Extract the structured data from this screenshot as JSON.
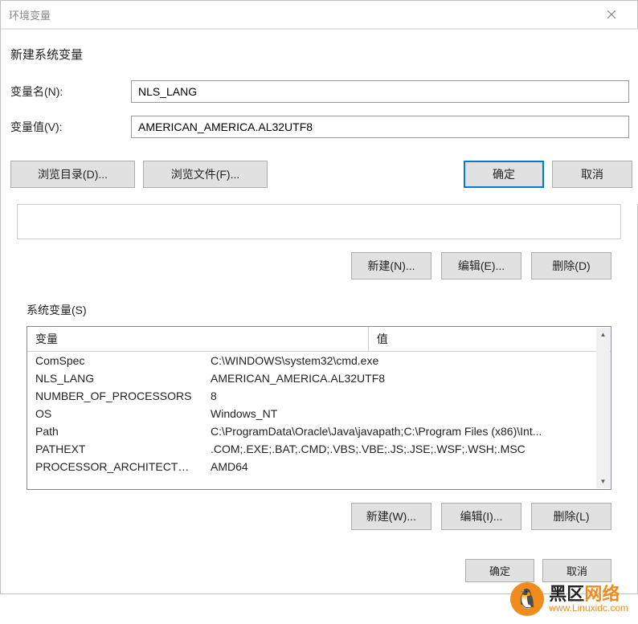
{
  "window": {
    "title": "环境变量"
  },
  "dialog": {
    "title": "新建系统变量",
    "labels": {
      "name": "变量名(N):",
      "value": "变量值(V):"
    },
    "fields": {
      "name": "NLS_LANG",
      "value": "AMERICAN_AMERICA.AL32UTF8"
    },
    "buttons": {
      "browse_dir": "浏览目录(D)...",
      "browse_file": "浏览文件(F)...",
      "ok": "确定",
      "cancel": "取消"
    }
  },
  "upper_actions": {
    "new": "新建(N)...",
    "edit": "编辑(E)...",
    "delete": "删除(D)"
  },
  "sys_vars": {
    "label": "系统变量(S)",
    "columns": {
      "var": "变量",
      "val": "值"
    },
    "rows": [
      {
        "name": "ComSpec",
        "value": "C:\\WINDOWS\\system32\\cmd.exe"
      },
      {
        "name": "NLS_LANG",
        "value": "AMERICAN_AMERICA.AL32UTF8"
      },
      {
        "name": "NUMBER_OF_PROCESSORS",
        "value": "8"
      },
      {
        "name": "OS",
        "value": "Windows_NT"
      },
      {
        "name": "Path",
        "value": "C:\\ProgramData\\Oracle\\Java\\javapath;C:\\Program Files (x86)\\Int..."
      },
      {
        "name": "PATHEXT",
        "value": ".COM;.EXE;.BAT;.CMD;.VBS;.VBE;.JS;.JSE;.WSF;.WSH;.MSC"
      },
      {
        "name": "PROCESSOR_ARCHITECTURE",
        "value": "AMD64"
      }
    ],
    "actions": {
      "new": "新建(W)...",
      "edit": "编辑(I)...",
      "delete": "删除(L)"
    }
  },
  "bottom": {
    "ok": "确定",
    "cancel": "取消"
  },
  "watermark": {
    "line1a": "黑区",
    "line1b": "网络",
    "line2": "www.Linuxidc.com"
  }
}
